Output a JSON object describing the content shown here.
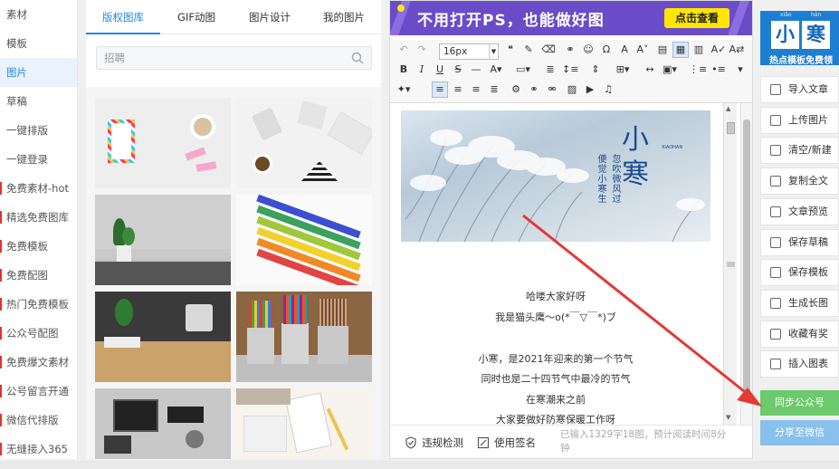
{
  "sidebar": {
    "items": [
      {
        "label": "素材"
      },
      {
        "label": "模板"
      },
      {
        "label": "图片"
      },
      {
        "label": "草稿"
      },
      {
        "label": "一键排版"
      },
      {
        "label": "一键登录"
      },
      {
        "label": "免费素材-hot"
      },
      {
        "label": "精选免费图库"
      },
      {
        "label": "免费模板"
      },
      {
        "label": "免费配图"
      },
      {
        "label": "热门免费模板"
      },
      {
        "label": "公众号配图"
      },
      {
        "label": "免费爆文素材"
      },
      {
        "label": "公号留言开通"
      },
      {
        "label": "微信代排版"
      },
      {
        "label": "无缝接入365"
      }
    ],
    "active_index": 2
  },
  "image_panel": {
    "tabs": [
      {
        "label": "版权图库"
      },
      {
        "label": "GIF动图"
      },
      {
        "label": "图片设计"
      },
      {
        "label": "我的图片"
      }
    ],
    "active_tab": 0,
    "search": {
      "placeholder": "招聘",
      "value": ""
    }
  },
  "editor": {
    "banner": {
      "text": "不用打开PS，也能做好图",
      "button": "点击查看"
    },
    "toolbar": {
      "font_size": "16px"
    },
    "hero": {
      "title": "小寒",
      "subtitle_left": "便觉小寒生",
      "subtitle_right": "忽吹微风过",
      "english": "XIAOHAN"
    },
    "paragraphs": [
      "哈喽大家好呀",
      "我是猫头鹰～o(*￣▽￣*)ブ",
      "",
      "小寒，是2021年迎来的第一个节气",
      "同时也是二十四节气中最冷的节气",
      "在寒潮来之前",
      "大家要做好防寒保暖工作呀"
    ],
    "bottom": {
      "check_label": "违规检测",
      "signature_label": "使用签名",
      "word_count": "已输入1329字18图，预计阅读时间8分钟"
    }
  },
  "right_panel": {
    "logo": {
      "pinyin_left": "xiǎo",
      "pinyin_right": "hán",
      "char_left": "小",
      "char_right": "寒",
      "slogan": "热点模板免费领"
    },
    "buttons": [
      {
        "label": "导入文章",
        "icon": "import-icon"
      },
      {
        "label": "上传图片",
        "icon": "image-upload-icon"
      },
      {
        "label": "清空/新建",
        "icon": "trash-icon"
      },
      {
        "label": "复制全文",
        "icon": "copy-icon"
      },
      {
        "label": "文章预览",
        "icon": "preview-icon"
      },
      {
        "label": "保存草稿",
        "icon": "save-icon"
      },
      {
        "label": "保存模板",
        "icon": "template-icon"
      },
      {
        "label": "生成长图",
        "icon": "long-image-icon"
      },
      {
        "label": "收藏有奖",
        "icon": "star-icon"
      },
      {
        "label": "插入图表",
        "icon": "chart-icon"
      }
    ],
    "sync_label": "同步公众号",
    "share_label": "分享至微信"
  },
  "colors": {
    "accent": "#1e88e5",
    "banner": "#6a4cc9",
    "banner_button": "#ffe600",
    "sync": "#6cc96c",
    "share": "#8ac0ec",
    "arrow": "#e53935"
  }
}
